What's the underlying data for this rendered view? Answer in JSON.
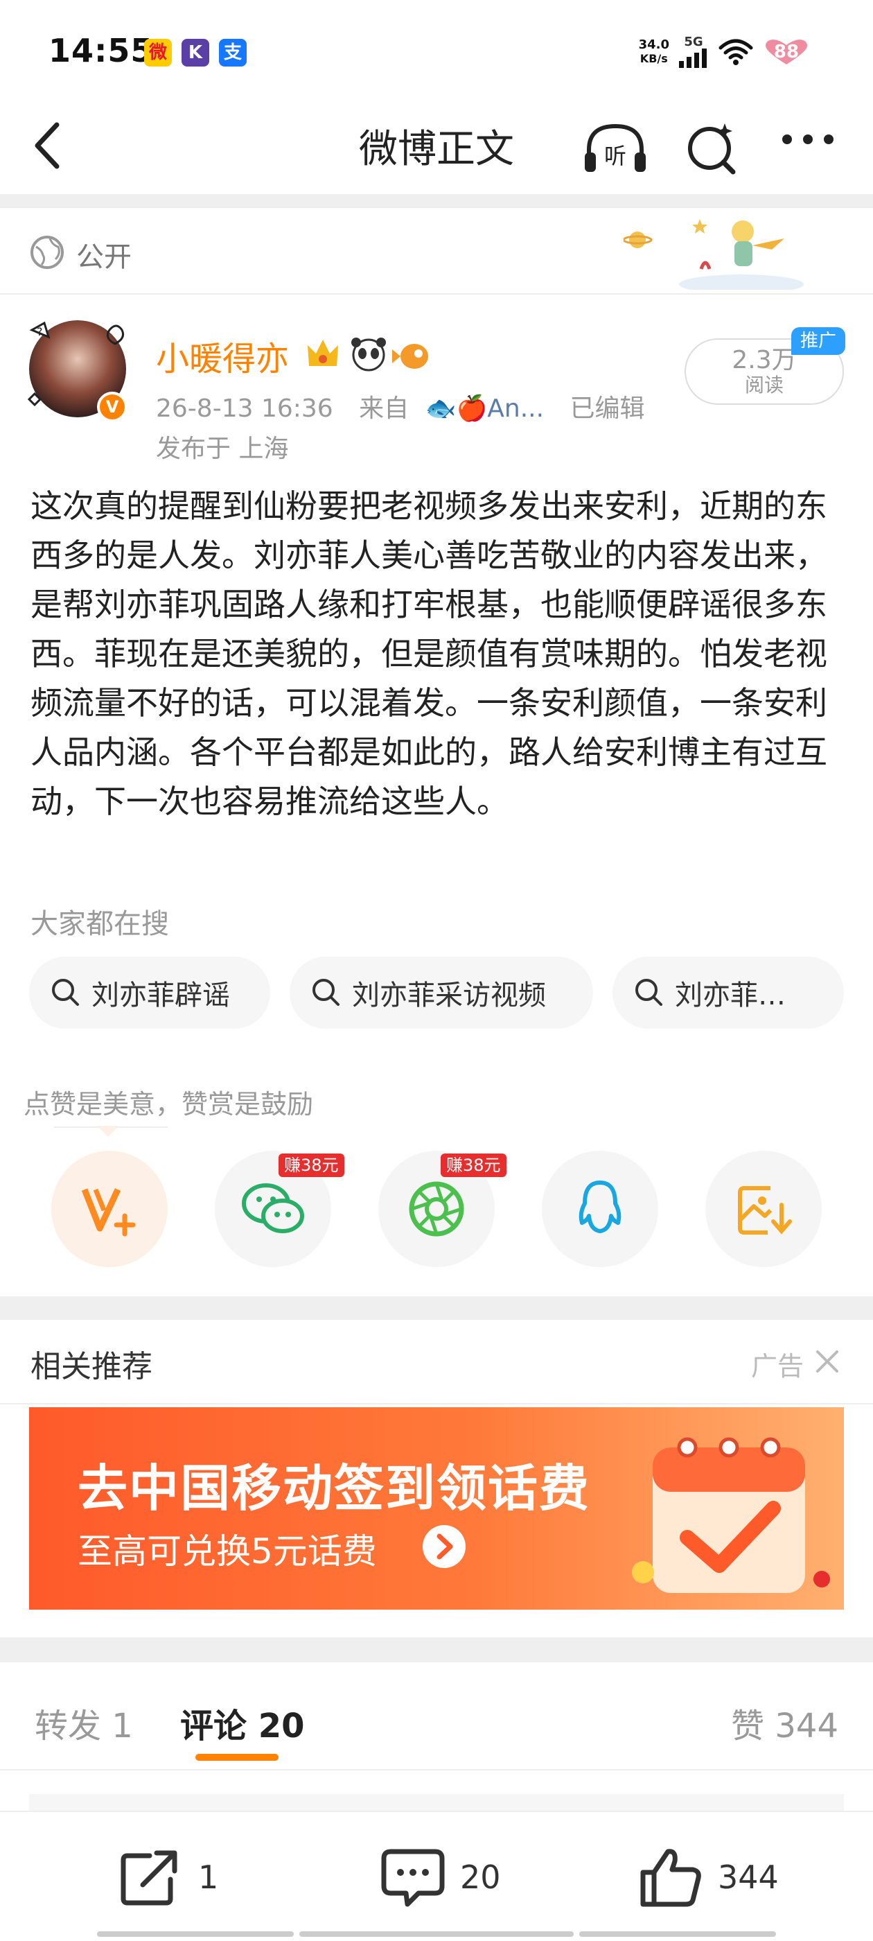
{
  "status_bar": {
    "time": "14:55",
    "app_icons": [
      {
        "name": "weibo-icon",
        "glyph": "微",
        "color": "#ffcc00"
      },
      {
        "name": "kuaishou-k-icon",
        "glyph": "K",
        "color": "#5a3fa6"
      },
      {
        "name": "alipay-icon",
        "glyph": "支",
        "color": "#1677ff"
      }
    ],
    "net_speed_value": "34.0",
    "net_speed_unit": "KB/s",
    "network_type": "5G",
    "battery": "88"
  },
  "nav": {
    "title": "微博正文"
  },
  "visibility": {
    "label": "公开"
  },
  "author": {
    "name": "小暖得亦",
    "verified_badge": "V",
    "time": "26-8-13 16:36",
    "source_prefix": "来自",
    "source": "🐟🍎An...",
    "edited": "已编辑",
    "location": "发布于 上海",
    "read_count": "2.3万",
    "read_label": "阅读",
    "promo_tag": "推广"
  },
  "post": {
    "text": "这次真的提醒到仙粉要把老视频多发出来安利，近期的东西多的是人发。刘亦菲人美心善吃苦敬业的内容发出来，是帮刘亦菲巩固路人缘和打牢根基，也能顺便辟谣很多东西。菲现在是还美貌的，但是颜值有赏味期的。怕发老视频流量不好的话，可以混着发。一条安利颜值，一条安利人品内涵。各个平台都是如此的，路人给安利博主有过互动，下一次也容易推流给这些人。"
  },
  "search": {
    "label": "大家都在搜",
    "chips": [
      "刘亦菲辟谣",
      "刘亦菲采访视频",
      "刘亦菲…"
    ]
  },
  "encourage": {
    "text": "点赞是美意，赞赏是鼓励",
    "earn_badge_1": "赚38元",
    "earn_badge_2": "赚38元"
  },
  "recommend": {
    "title": "相关推荐",
    "ad_label": "广告",
    "ad_headline": "去中国移动签到领话费",
    "ad_sub": "至高可兑换5元话费"
  },
  "tabs": {
    "repost": "转发 1",
    "comments": "评论 20",
    "likes": "赞 344"
  },
  "actions": {
    "repost_count": "1",
    "comment_count": "20",
    "like_count": "344"
  },
  "colors": {
    "accent": "#ff8200",
    "link": "#5b7cab",
    "promo": "#2da0ff"
  }
}
